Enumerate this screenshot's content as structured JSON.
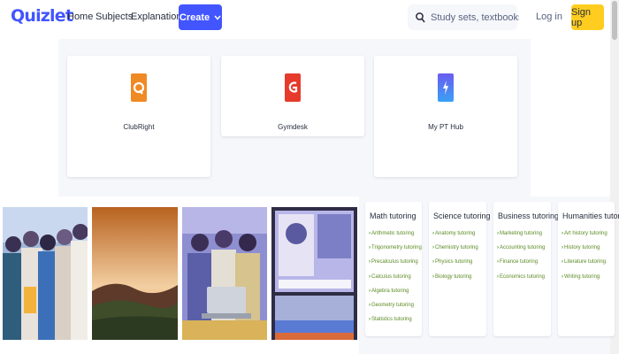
{
  "header": {
    "logo": "Quizlet",
    "nav": {
      "home": "Home",
      "subjects": "Subjects",
      "explanations": "Explanations"
    },
    "create_label": "Create",
    "search_placeholder": "Study sets, textbooks, ...",
    "login_label": "Log in",
    "signup_label": "Sign up"
  },
  "apps": [
    {
      "name": "ClubRight",
      "icon": "clubright-logo-icon",
      "color": "#f08a24"
    },
    {
      "name": "Gymdesk",
      "icon": "gymdesk-logo-icon",
      "color": "#e53a2c"
    },
    {
      "name": "My PT Hub",
      "icon": "my-pt-hub-logo-icon",
      "color": "#4a6cf7"
    }
  ],
  "tutoring": [
    {
      "title": "Math tutoring",
      "links": [
        "Arithmetic tutoring",
        "Trigonometry tutoring",
        "Precalculus tutoring",
        "Calculus tutoring",
        "Algebra tutoring",
        "Geometry tutoring",
        "Statistics tutoring"
      ]
    },
    {
      "title": "Science tutoring",
      "links": [
        "Anatomy tutoring",
        "Chemistry tutoring",
        "Physics tutoring",
        "Biology tutoring"
      ]
    },
    {
      "title": "Business tutoring",
      "links": [
        "Marketing tutoring",
        "Accounting tutoring",
        "Finance tutoring",
        "Economics tutoring"
      ]
    },
    {
      "title": "Humanities tutoring",
      "links": [
        "Art history tutoring",
        "History tutoring",
        "Literature tutoring",
        "Writing tutoring"
      ]
    }
  ],
  "colors": {
    "brand": "#4255ff",
    "signup": "#ffcd1f",
    "link_green": "#5a8a22",
    "panel_bg": "#f6f7fb"
  }
}
